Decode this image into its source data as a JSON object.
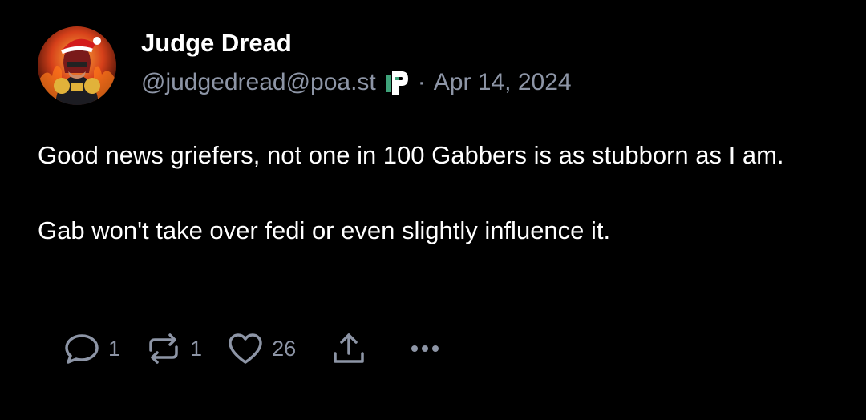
{
  "post": {
    "author": {
      "display_name": "Judge Dread",
      "handle": "@judgedread@poa.st",
      "platform_icon": "pleroma-icon"
    },
    "separator": "·",
    "date": "Apr 14, 2024",
    "body": [
      "Good news griefers, not one in 100 Gabbers is as stubborn as I am.",
      "Gab won't take over fedi or even slightly influence it."
    ],
    "actions": {
      "reply": {
        "icon": "reply-icon",
        "count": "1"
      },
      "repost": {
        "icon": "repost-icon",
        "count": "1"
      },
      "like": {
        "icon": "heart-icon",
        "count": "26"
      },
      "share": {
        "icon": "share-icon"
      },
      "more": {
        "icon": "more-icon"
      }
    }
  },
  "colors": {
    "background": "#000000",
    "text": "#ffffff",
    "muted": "#8d95a6"
  }
}
